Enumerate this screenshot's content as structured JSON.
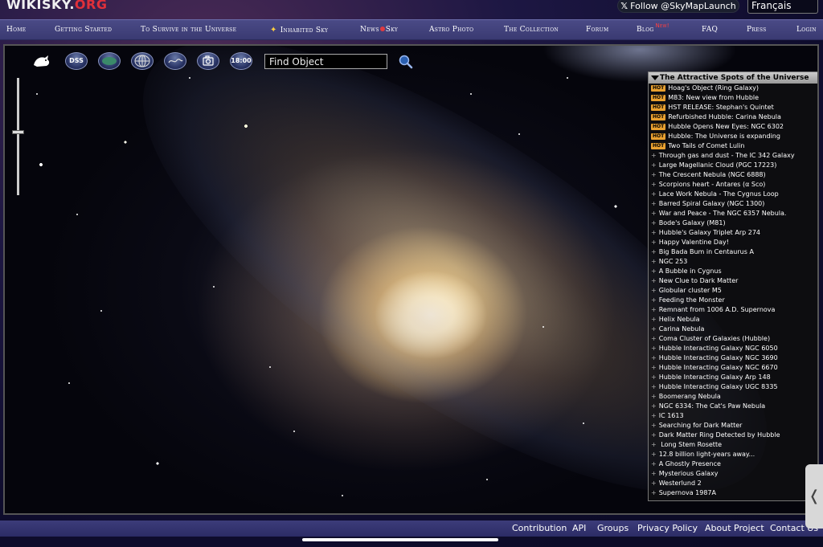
{
  "header": {
    "logo_main": "WIKISKY.",
    "logo_org": "ORG",
    "follow_label": "Follow @SkyMapLaunch",
    "language": "Français"
  },
  "nav": [
    {
      "label": "Home"
    },
    {
      "label": "Getting Started"
    },
    {
      "label": "To Survive in the Universe"
    },
    {
      "label": "Inhabited Sky"
    },
    {
      "label": "News",
      "label2": "Sky"
    },
    {
      "label": "Astro Photo"
    },
    {
      "label": "The Collection"
    },
    {
      "label": "Forum"
    },
    {
      "label": "Blog",
      "badge": "New!"
    },
    {
      "label": "FAQ"
    },
    {
      "label": "Press"
    },
    {
      "label": "Login"
    }
  ],
  "toolbar": {
    "dss_label": "DSS",
    "time_label": "18:00",
    "search_placeholder": "Find Object"
  },
  "spots_panel": {
    "title": "The Attractive Spots of the Universe",
    "hot_badge": "HOT",
    "items": [
      {
        "label": "Hoag's Object (Ring Galaxy)",
        "hot": true
      },
      {
        "label": "M83: New view from Hubble",
        "hot": true
      },
      {
        "label": "HST RELEASE: Stephan's Quintet",
        "hot": true
      },
      {
        "label": "Refurbished Hubble: Carina Nebula",
        "hot": true
      },
      {
        "label": "Hubble Opens New Eyes: NGC 6302",
        "hot": true
      },
      {
        "label": "Hubble: The Universe is expanding",
        "hot": true
      },
      {
        "label": "Two Tails of Comet Lulin",
        "hot": true
      },
      {
        "label": "Through gas and dust - The IC 342 Galaxy",
        "hot": false
      },
      {
        "label": "Large Magellanic Cloud (PGC 17223)",
        "hot": false
      },
      {
        "label": "The Crescent Nebula (NGC 6888)",
        "hot": false
      },
      {
        "label": "Scorpions heart - Antares (α Sco)",
        "hot": false
      },
      {
        "label": "Lace Work Nebula - The Cygnus Loop",
        "hot": false
      },
      {
        "label": "Barred Spiral Galaxy (NGC 1300)",
        "hot": false
      },
      {
        "label": "War and Peace - The NGC 6357 Nebula.",
        "hot": false
      },
      {
        "label": "Bode's Galaxy (M81)",
        "hot": false
      },
      {
        "label": "Hubble's Galaxy Triplet Arp 274",
        "hot": false
      },
      {
        "label": "Happy Valentine Day!",
        "hot": false
      },
      {
        "label": "Big Bada Bum in Centaurus A",
        "hot": false
      },
      {
        "label": "NGC 253",
        "hot": false
      },
      {
        "label": "A Bubble in Cygnus",
        "hot": false
      },
      {
        "label": "New Clue to Dark Matter",
        "hot": false
      },
      {
        "label": "Globular cluster M5",
        "hot": false
      },
      {
        "label": "Feeding the Monster",
        "hot": false
      },
      {
        "label": "Remnant from 1006 A.D. Supernova",
        "hot": false
      },
      {
        "label": "Helix Nebula",
        "hot": false
      },
      {
        "label": "Carina Nebula",
        "hot": false
      },
      {
        "label": "Coma Cluster of Galaxies (Hubble)",
        "hot": false
      },
      {
        "label": "Hubble Interacting Galaxy NGC 6050",
        "hot": false
      },
      {
        "label": "Hubble Interacting Galaxy NGC 3690",
        "hot": false
      },
      {
        "label": "Hubble Interacting Galaxy NGC 6670",
        "hot": false
      },
      {
        "label": "Hubble Interacting Galaxy Arp 148",
        "hot": false
      },
      {
        "label": "Hubble Interacting Galaxy UGC 8335",
        "hot": false
      },
      {
        "label": "Boomerang Nebula",
        "hot": false
      },
      {
        "label": "NGC 6334: The Cat's Paw Nebula",
        "hot": false
      },
      {
        "label": "IC 1613",
        "hot": false
      },
      {
        "label": "Searching for Dark Matter",
        "hot": false
      },
      {
        "label": "Dark Matter Ring Detected by Hubble",
        "hot": false
      },
      {
        "label": " Long Stem Rosette",
        "hot": false
      },
      {
        "label": "12.8 billion light-years away...",
        "hot": false
      },
      {
        "label": "A Ghostly Presence",
        "hot": false
      },
      {
        "label": "Mysterious Galaxy",
        "hot": false
      },
      {
        "label": "Westerlund 2",
        "hot": false
      },
      {
        "label": "Supernova 1987A",
        "hot": false
      }
    ]
  },
  "footer": {
    "contribution": "Contribution",
    "api": "API",
    "groups": "Groups",
    "privacy": "Privacy Policy",
    "about": "About Project",
    "contact": "Contact Us"
  },
  "colors": {
    "nav_bg": "#3f3f7c",
    "logo_accent": "#e0303a",
    "hot_badge": "#e8a030"
  }
}
